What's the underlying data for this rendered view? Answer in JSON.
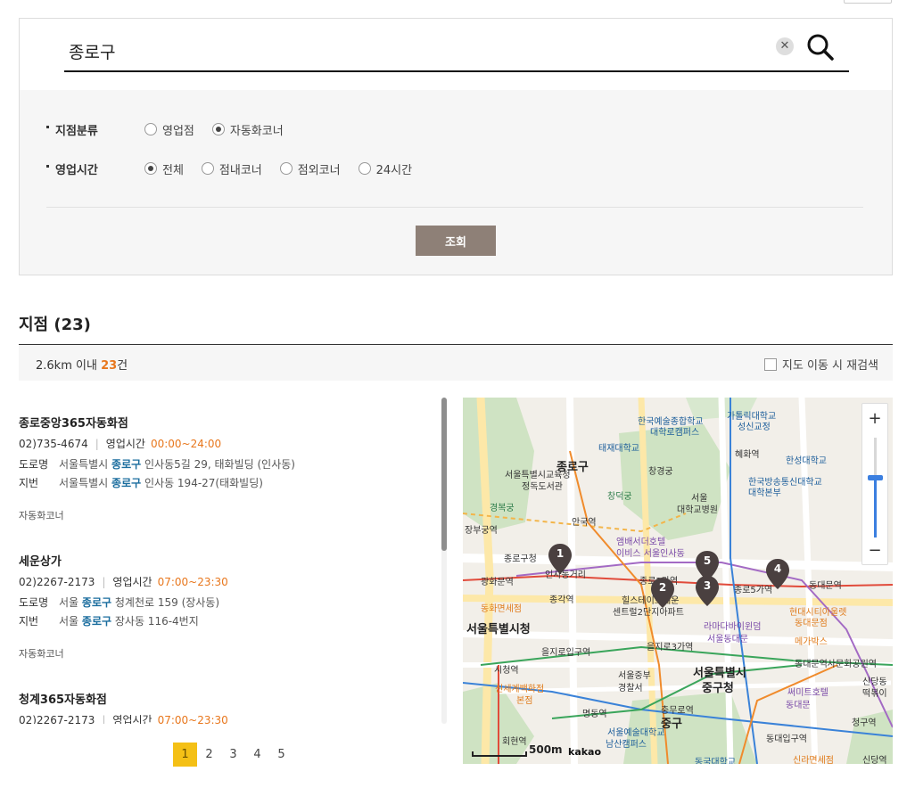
{
  "search": {
    "value": "종로구"
  },
  "filters": {
    "branch_type": {
      "label": "지점분류",
      "options": [
        {
          "label": "영업점",
          "checked": false
        },
        {
          "label": "자동화코너",
          "checked": true
        }
      ]
    },
    "hours": {
      "label": "영업시간",
      "options": [
        {
          "label": "전체",
          "checked": true
        },
        {
          "label": "점내코너",
          "checked": false
        },
        {
          "label": "점외코너",
          "checked": false
        },
        {
          "label": "24시간",
          "checked": false
        }
      ]
    },
    "query_button": "조회"
  },
  "results": {
    "title": "지점 (23)",
    "range_prefix": "2.6km 이내",
    "count": "23",
    "count_suffix": "건",
    "research_label": "지도 이동 시 재검색"
  },
  "branches": [
    {
      "name": "종로중앙365자동화점",
      "phone": "02)735-4674",
      "hours_label": "영업시간",
      "hours": "00:00~24:00",
      "road_label": "도로명",
      "road_prefix": "서울특별시",
      "road_hl": "종로구",
      "road_rest": "인사동5길 29, 태화빌딩 (인사동)",
      "lot_label": "지번",
      "lot_prefix": "서울특별시",
      "lot_hl": "종로구",
      "lot_rest": "인사동 194-27(태화빌딩)",
      "type": "자동화코너"
    },
    {
      "name": "세운상가",
      "phone": "02)2267-2173",
      "hours_label": "영업시간",
      "hours": "07:00~23:30",
      "road_label": "도로명",
      "road_prefix": "서울",
      "road_hl": "종로구",
      "road_rest": "청계천로 159 (장사동)",
      "lot_label": "지번",
      "lot_prefix": "서울",
      "lot_hl": "종로구",
      "lot_rest": "장사동 116-4번지",
      "type": "자동화코너"
    },
    {
      "name": "청계365자동화점",
      "phone": "02)2267-2173",
      "hours_label": "영업시간",
      "hours": "07:00~23:30"
    }
  ],
  "pager": [
    "1",
    "2",
    "3",
    "4",
    "5"
  ],
  "map": {
    "zoom_in": "+",
    "zoom_out": "−",
    "scale": "500m",
    "brand": "kakao",
    "markers": [
      "1",
      "2",
      "3",
      "4",
      "5"
    ],
    "labels": {
      "l1": "한국예술종합학교",
      "l2": "대학로캠퍼스",
      "l3": "가톨릭대학교",
      "l4": "성신교정",
      "l5": "태재대학교",
      "l6": "혜화역",
      "l7": "한성대학교",
      "l8": "종로구",
      "l9": "서울특별시교육청",
      "l10": "정독도서관",
      "l11": "창경궁",
      "l12": "서울",
      "l13": "대학교병원",
      "l14": "한국방송통신대학교",
      "l15": "대학본부",
      "l16": "창덕궁",
      "l17": "경복궁",
      "l18": "안국역",
      "l19": "장부궁역",
      "l20": "앰배서더호텔",
      "l21": "이비스 서울인사동",
      "l22": "종로구청",
      "l23": "인사동거리",
      "l24": "광화문역",
      "l25": "종로3가역",
      "l26": "종로5가역",
      "l27": "동대문역",
      "l28": "종각역",
      "l29": "힐스테이트세운",
      "l30": "센트럴2단지아파트",
      "l31": "현대시티아울렛",
      "l32": "동대문점",
      "l33": "동화면세점",
      "l34": "서울특별시청",
      "l35": "라마다바이윈덤",
      "l36": "서울동대문",
      "l37": "을지로입구역",
      "l38": "을지로3가역",
      "l39": "메가박스",
      "l40": "시청역",
      "l41": "서울중부",
      "l42": "경찰서",
      "l43": "서울특별시",
      "l44": "중구청",
      "l45": "동대문역사문화공원역",
      "l46": "신세계백화점",
      "l47": "본점",
      "l48": "써미트호텔",
      "l49": "동대문",
      "l50": "신당동",
      "l51": "떡볶이",
      "l52": "명동역",
      "l53": "충무로역",
      "l54": "중구",
      "l55": "청구역",
      "l56": "서울예술대학교",
      "l57": "남산캠퍼스",
      "l58": "회현역",
      "l59": "동대입구역",
      "l60": "신라면세점",
      "l61": "동국대학교",
      "l62": "신당역"
    }
  }
}
